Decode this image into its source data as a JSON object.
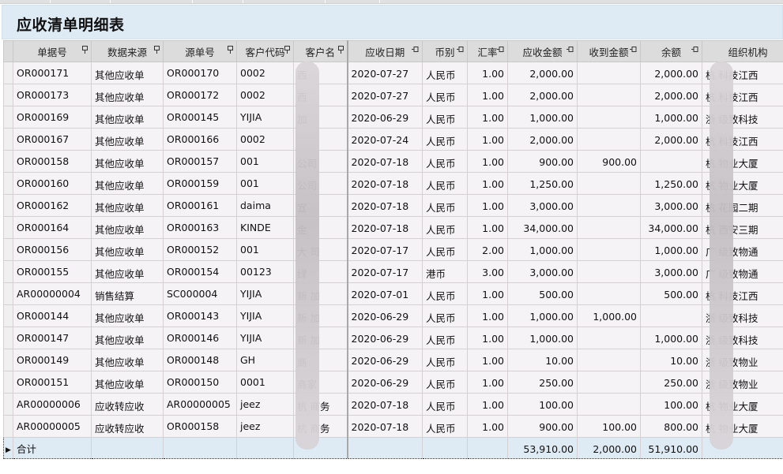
{
  "report": {
    "title": "应收清单明细表"
  },
  "columns": [
    {
      "key": "doc_no",
      "label": "单据号"
    },
    {
      "key": "source_type",
      "label": "数据来源"
    },
    {
      "key": "source_no",
      "label": "源单号"
    },
    {
      "key": "customer_code",
      "label": "客户代码"
    },
    {
      "key": "customer_name",
      "label": "客户名"
    },
    {
      "key": "date",
      "label": "应收日期"
    },
    {
      "key": "currency",
      "label": "币别"
    },
    {
      "key": "rate",
      "label": "汇率"
    },
    {
      "key": "receivable",
      "label": "应收金额"
    },
    {
      "key": "received",
      "label": "收到金额"
    },
    {
      "key": "balance",
      "label": "余额"
    },
    {
      "key": "org",
      "label": "组织机构"
    }
  ],
  "icons": {
    "pin": "pin-icon",
    "row_pointer": "row-pointer-icon"
  },
  "rows": [
    {
      "doc_no": "OR000171",
      "source_type": "其他应收单",
      "source_no": "OR000170",
      "customer_code": "0002",
      "customer_name": "西",
      "date": "2020-07-27",
      "currency": "人民币",
      "rate": "1.00",
      "receivable": "2,000.00",
      "received": "",
      "balance": "2,000.00",
      "org": "杭 科技江西"
    },
    {
      "doc_no": "OR000173",
      "source_type": "其他应收单",
      "source_no": "OR000172",
      "customer_code": "0002",
      "customer_name": "西",
      "date": "2020-07-27",
      "currency": "人民币",
      "rate": "1.00",
      "receivable": "2,000.00",
      "received": "",
      "balance": "2,000.00",
      "org": "杭 科技江西"
    },
    {
      "doc_no": "OR000169",
      "source_type": "其他应收单",
      "source_no": "OR000145",
      "customer_code": "YIJIA",
      "customer_name": "加",
      "date": "2020-06-29",
      "currency": "人民币",
      "rate": "1.00",
      "receivable": "1,000.00",
      "received": "",
      "balance": "1,000.00",
      "org": "浙 级致科技"
    },
    {
      "doc_no": "OR000167",
      "source_type": "其他应收单",
      "source_no": "OR000166",
      "customer_code": "0002",
      "customer_name": "",
      "date": "2020-07-24",
      "currency": "人民币",
      "rate": "1.00",
      "receivable": "2,000.00",
      "received": "",
      "balance": "2,000.00",
      "org": "杭 科技江西"
    },
    {
      "doc_no": "OR000158",
      "source_type": "其他应收单",
      "source_no": "OR000157",
      "customer_code": "001",
      "customer_name": "公司",
      "date": "2020-07-18",
      "currency": "人民币",
      "rate": "1.00",
      "receivable": "900.00",
      "received": "900.00",
      "balance": "",
      "org": "杭 物业大厦"
    },
    {
      "doc_no": "OR000160",
      "source_type": "其他应收单",
      "source_no": "OR000159",
      "customer_code": "001",
      "customer_name": "公司",
      "date": "2020-07-18",
      "currency": "人民币",
      "rate": "1.00",
      "receivable": "1,250.00",
      "received": "",
      "balance": "1,250.00",
      "org": "杭 物业大厦"
    },
    {
      "doc_no": "OR000162",
      "source_type": "其他应收单",
      "source_no": "OR000161",
      "customer_code": "daima",
      "customer_name": "宜",
      "date": "2020-07-18",
      "currency": "人民币",
      "rate": "1.00",
      "receivable": "3,000.00",
      "received": "",
      "balance": "3,000.00",
      "org": "杭 花园二期"
    },
    {
      "doc_no": "OR000164",
      "source_type": "其他应收单",
      "source_no": "OR000163",
      "customer_code": "KINDE",
      "customer_name": "金",
      "date": "2020-07-18",
      "currency": "人民币",
      "rate": "1.00",
      "receivable": "34,000.00",
      "received": "",
      "balance": "34,000.00",
      "org": "杭 西安三期"
    },
    {
      "doc_no": "OR000156",
      "source_type": "其他应收单",
      "source_no": "OR000152",
      "customer_code": "001",
      "customer_name": "大 司",
      "date": "2020-07-17",
      "currency": "人民币",
      "rate": "2.00",
      "receivable": "1,000.00",
      "received": "",
      "balance": "1,000.00",
      "org": "广 级致物通"
    },
    {
      "doc_no": "OR000155",
      "source_type": "其他应收单",
      "source_no": "OR000154",
      "customer_code": "00123",
      "customer_name": "绿",
      "date": "2020-07-17",
      "currency": "港币",
      "rate": "3.00",
      "receivable": "3,000.00",
      "received": "",
      "balance": "3,000.00",
      "org": "广 级致物通"
    },
    {
      "doc_no": "AR00000004",
      "source_type": "销售结算",
      "source_no": "SC000004",
      "customer_code": "YIJIA",
      "customer_name": "新 加",
      "date": "2020-07-01",
      "currency": "人民币",
      "rate": "1.00",
      "receivable": "500.00",
      "received": "",
      "balance": "500.00",
      "org": "杭 科技江西"
    },
    {
      "doc_no": "OR000144",
      "source_type": "其他应收单",
      "source_no": "OR000143",
      "customer_code": "YIJIA",
      "customer_name": "新 加",
      "date": "2020-06-29",
      "currency": "人民币",
      "rate": "1.00",
      "receivable": "1,000.00",
      "received": "1,000.00",
      "balance": "",
      "org": "浙 级致科技"
    },
    {
      "doc_no": "OR000147",
      "source_type": "其他应收单",
      "source_no": "OR000146",
      "customer_code": "YIJIA",
      "customer_name": "新 加",
      "date": "2020-06-29",
      "currency": "人民币",
      "rate": "1.00",
      "receivable": "1,000.00",
      "received": "",
      "balance": "1,000.00",
      "org": "浙 级致科技"
    },
    {
      "doc_no": "OR000149",
      "source_type": "其他应收单",
      "source_no": "OR000148",
      "customer_code": "GH",
      "customer_name": "商",
      "date": "2020-06-29",
      "currency": "人民币",
      "rate": "1.00",
      "receivable": "10.00",
      "received": "",
      "balance": "10.00",
      "org": "浙 级致物业"
    },
    {
      "doc_no": "OR000151",
      "source_type": "其他应收单",
      "source_no": "OR000150",
      "customer_code": "0001",
      "customer_name": "商家",
      "date": "2020-06-29",
      "currency": "人民币",
      "rate": "1.00",
      "receivable": "250.00",
      "received": "",
      "balance": "250.00",
      "org": "浙 级致物业"
    },
    {
      "doc_no": "AR00000006",
      "source_type": "应收转应收",
      "source_no": "AR00000005",
      "customer_code": "jeez",
      "customer_name": "杭 商务",
      "date": "2020-07-18",
      "currency": "人民币",
      "rate": "1.00",
      "receivable": "100.00",
      "received": "",
      "balance": "100.00",
      "org": "杭 物业大厦"
    },
    {
      "doc_no": "AR00000005",
      "source_type": "应收转应收",
      "source_no": "OR000158",
      "customer_code": "jeez",
      "customer_name": "杭 商务",
      "date": "2020-07-18",
      "currency": "人民币",
      "rate": "1.00",
      "receivable": "900.00",
      "received": "100.00",
      "balance": "800.00",
      "org": "杭 物业大厦"
    }
  ],
  "totals": {
    "label": "合计",
    "receivable": "53,910.00",
    "received": "2,000.00",
    "balance": "51,910.00"
  },
  "colors": {
    "title_bg": "#deebf5",
    "header_bg": "#dcdcdc",
    "row_bg": "#f6f3f6",
    "total_bg": "#deebf5"
  }
}
